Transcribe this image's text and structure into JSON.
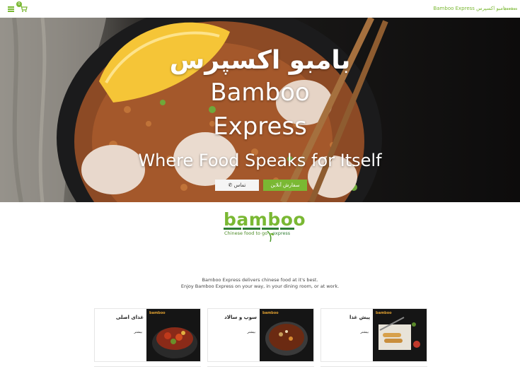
{
  "topbar": {
    "brand_title": "Bamboo Express بامبو اکسپرس",
    "brand_mini": "bamboo",
    "cart_count": "0",
    "menu_icon": "hamburger-icon",
    "cart_icon": "cart-icon"
  },
  "hero": {
    "title_fa": "بامبو اکسپرس",
    "title_en_line1": "Bamboo",
    "title_en_line2": "Express",
    "tagline": "Where Food Speaks for Itself",
    "btn_contact": "✆ تماس",
    "btn_order": "سفارش آنلاین"
  },
  "logo": {
    "word": "bamboo",
    "sub": "Chinese food to go",
    "express": "express"
  },
  "intro": {
    "line1": "Bamboo Express delivers chinese food at it's best.",
    "line2": "Enjoy Bamboo Express on your way, in your dining room, or at work."
  },
  "cards": [
    {
      "category": "غذای اصلی",
      "more": "بیشتر",
      "thumb_logo": "bamboo"
    },
    {
      "category": "سوپ و سالاد",
      "more": "بیشتر",
      "thumb_logo": "bamboo"
    },
    {
      "category": "پیش غذا",
      "more": "بیشتر",
      "thumb_logo": "bamboo"
    }
  ],
  "colors": {
    "accent": "#7ab833",
    "dark_green": "#2e7d32"
  }
}
